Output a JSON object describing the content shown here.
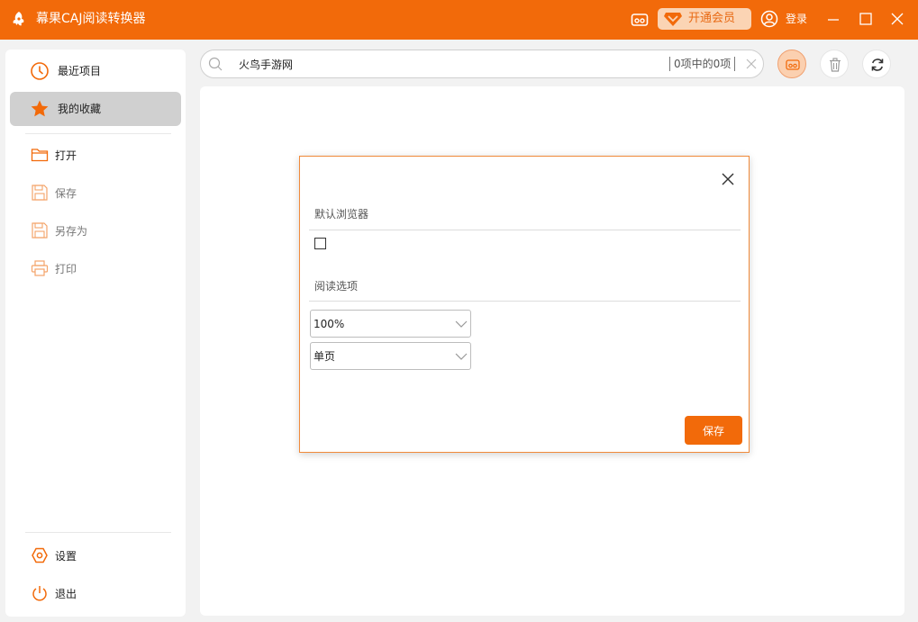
{
  "app": {
    "title": "幕果CAJ阅读转换器",
    "vip_label": "开通会员",
    "login_label": "登录"
  },
  "colors": {
    "brand": "#f26a0a",
    "vip_bg": "#fbd4b4",
    "active_nav": "#d0d0d0"
  },
  "sidebar": {
    "nav": [
      {
        "label": "最近项目",
        "icon": "clock-icon"
      },
      {
        "label": "我的收藏",
        "icon": "star-icon"
      }
    ],
    "file_actions": [
      {
        "label": "打开",
        "icon": "folder-icon"
      },
      {
        "label": "保存",
        "icon": "save-icon"
      },
      {
        "label": "另存为",
        "icon": "save-as-icon"
      },
      {
        "label": "打印",
        "icon": "printer-icon"
      }
    ],
    "bottom": [
      {
        "label": "设置",
        "icon": "gear-icon"
      },
      {
        "label": "退出",
        "icon": "power-icon"
      }
    ]
  },
  "search": {
    "value": "火鸟手游网",
    "result_count": "0项中的0项"
  },
  "dialog": {
    "section_browser": "默认浏览器",
    "browser_checked": false,
    "section_reading": "阅读选项",
    "zoom_value": "100%",
    "page_mode_value": "单页",
    "save_label": "保存"
  }
}
